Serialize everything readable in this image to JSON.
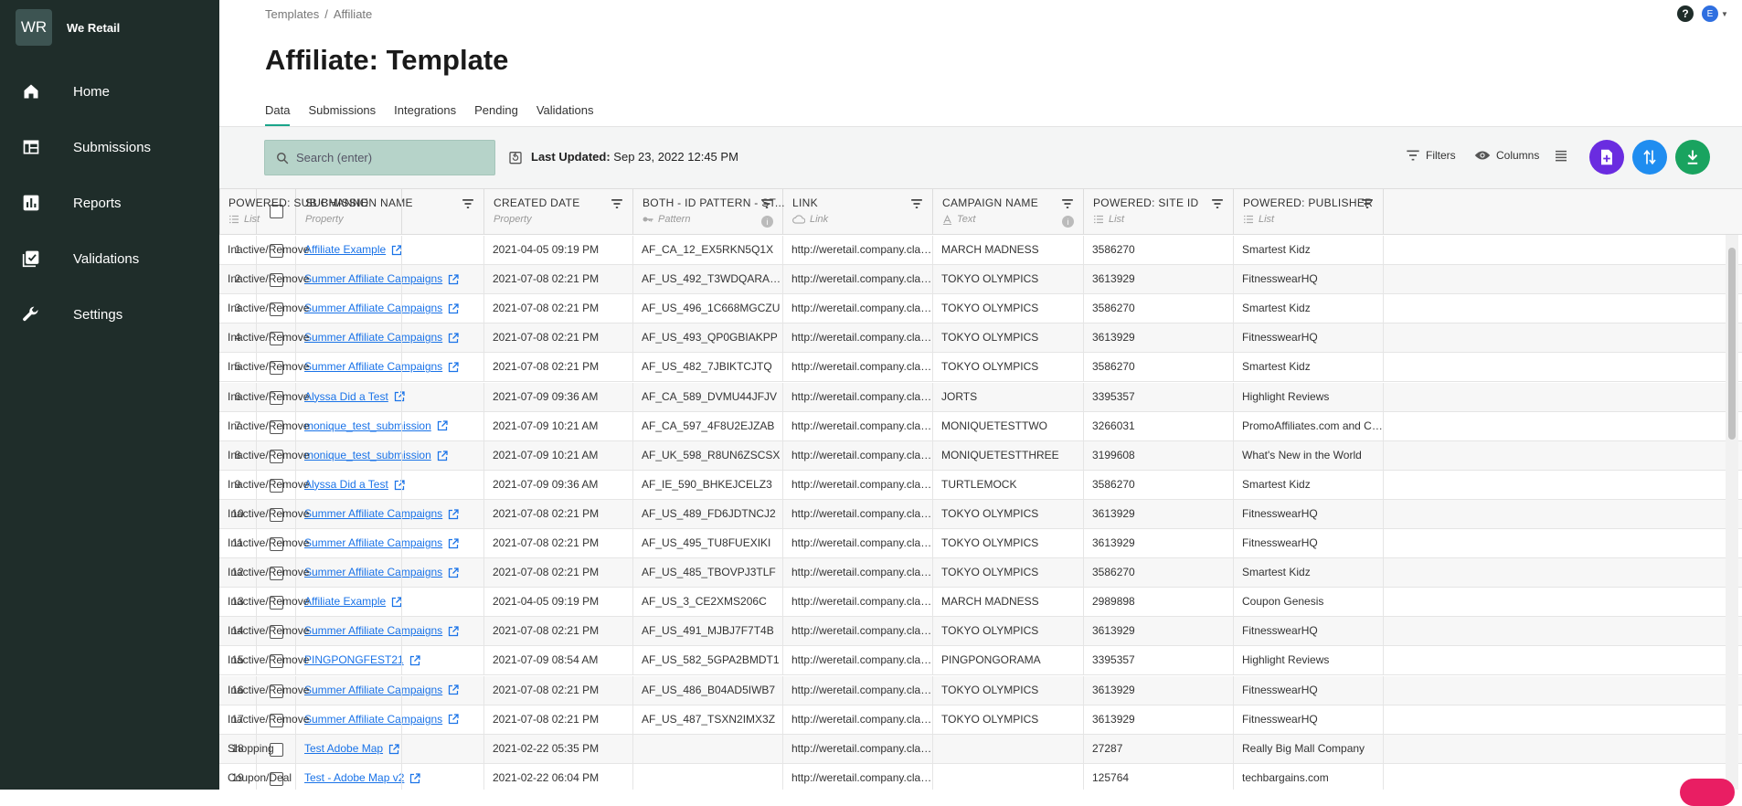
{
  "app": {
    "logo_text": "WR",
    "name": "We Retail"
  },
  "sidebar": {
    "items": [
      {
        "label": "Home",
        "icon": "home-icon"
      },
      {
        "label": "Submissions",
        "icon": "table-icon"
      },
      {
        "label": "Reports",
        "icon": "chart-icon"
      },
      {
        "label": "Validations",
        "icon": "checklist-icon"
      },
      {
        "label": "Settings",
        "icon": "wrench-icon"
      }
    ]
  },
  "breadcrumb": {
    "parent": "Templates",
    "sep": "/",
    "current": "Affiliate"
  },
  "header": {
    "help": "?",
    "user_initial": "E",
    "title": "Affiliate: Template"
  },
  "tabs": [
    "Data",
    "Submissions",
    "Integrations",
    "Pending",
    "Validations"
  ],
  "toolbar": {
    "search_placeholder": "Search (enter)",
    "last_updated_label": "Last Updated:",
    "last_updated_value": "Sep 23, 2022 12:45 PM",
    "filters_label": "Filters",
    "columns_label": "Columns"
  },
  "columns": [
    {
      "title": "SUBMISSION NAME",
      "type": "Property",
      "type_icon": ""
    },
    {
      "title": "CREATED DATE",
      "type": "Property",
      "type_icon": ""
    },
    {
      "title": "BOTH - ID PATTERN - ST...",
      "type": "Pattern",
      "type_icon": "key-icon"
    },
    {
      "title": "LINK",
      "type": "Link",
      "type_icon": "cloud-icon"
    },
    {
      "title": "CAMPAIGN NAME",
      "type": "Text",
      "type_icon": "text-icon"
    },
    {
      "title": "POWERED: SITE ID",
      "type": "List",
      "type_icon": "list-icon"
    },
    {
      "title": "POWERED: PUBLISHER",
      "type": "List",
      "type_icon": "list-icon"
    },
    {
      "title": "POWERED: SUB CHANNE",
      "type": "List",
      "type_icon": "list-icon"
    }
  ],
  "rows": [
    [
      "1",
      "Affiliate Example",
      "2021-04-05 09:19 PM",
      "AF_CA_12_EX5RKN5Q1X",
      "http://weretail.company.claravi...",
      "MARCH MADNESS",
      "3586270",
      "Smartest Kidz",
      "Inactive/Remove"
    ],
    [
      "2",
      "Summer Affiliate Campaigns",
      "2021-07-08 02:21 PM",
      "AF_US_492_T3WDQARA7M",
      "http://weretail.company.claravi...",
      "TOKYO OLYMPICS",
      "3613929",
      "FitnesswearHQ",
      "Inactive/Remove"
    ],
    [
      "3",
      "Summer Affiliate Campaigns",
      "2021-07-08 02:21 PM",
      "AF_US_496_1C668MGCZU",
      "http://weretail.company.claravi...",
      "TOKYO OLYMPICS",
      "3586270",
      "Smartest Kidz",
      "Inactive/Remove"
    ],
    [
      "4",
      "Summer Affiliate Campaigns",
      "2021-07-08 02:21 PM",
      "AF_US_493_QP0GBIAKPP",
      "http://weretail.company.claravi...",
      "TOKYO OLYMPICS",
      "3613929",
      "FitnesswearHQ",
      "Inactive/Remove"
    ],
    [
      "5",
      "Summer Affiliate Campaigns",
      "2021-07-08 02:21 PM",
      "AF_US_482_7JBIKTCJTQ",
      "http://weretail.company.claravi...",
      "TOKYO OLYMPICS",
      "3586270",
      "Smartest Kidz",
      "Inactive/Remove"
    ],
    [
      "6",
      "Alyssa Did a Test",
      "2021-07-09 09:36 AM",
      "AF_CA_589_DVMU44JFJV",
      "http://weretail.company.claravi...",
      "JORTS",
      "3395357",
      "Highlight Reviews",
      "Inactive/Remove"
    ],
    [
      "7",
      "monique_test_submission",
      "2021-07-09 10:21 AM",
      "AF_CA_597_4F8U2EJZAB",
      "http://weretail.company.claravi...",
      "MONIQUETESTTWO",
      "3266031",
      "PromoAffiliates.com and Coupo...",
      "Inactive/Remove"
    ],
    [
      "8",
      "monique_test_submission",
      "2021-07-09 10:21 AM",
      "AF_UK_598_R8UN6ZSCSX",
      "http://weretail.company.claravi...",
      "MONIQUETESTTHREE",
      "3199608",
      "What's New in the World",
      "Inactive/Remove"
    ],
    [
      "9",
      "Alyssa Did a Test",
      "2021-07-09 09:36 AM",
      "AF_IE_590_BHKEJCELZ3",
      "http://weretail.company.claravi...",
      "TURTLEMOCK",
      "3586270",
      "Smartest Kidz",
      "Inactive/Remove"
    ],
    [
      "10",
      "Summer Affiliate Campaigns",
      "2021-07-08 02:21 PM",
      "AF_US_489_FD6JDTNCJ2",
      "http://weretail.company.claravi...",
      "TOKYO OLYMPICS",
      "3613929",
      "FitnesswearHQ",
      "Inactive/Remove"
    ],
    [
      "11",
      "Summer Affiliate Campaigns",
      "2021-07-08 02:21 PM",
      "AF_US_495_TU8FUEXIKI",
      "http://weretail.company.claravi...",
      "TOKYO OLYMPICS",
      "3613929",
      "FitnesswearHQ",
      "Inactive/Remove"
    ],
    [
      "12",
      "Summer Affiliate Campaigns",
      "2021-07-08 02:21 PM",
      "AF_US_485_TBOVPJ3TLF",
      "http://weretail.company.claravi...",
      "TOKYO OLYMPICS",
      "3586270",
      "Smartest Kidz",
      "Inactive/Remove"
    ],
    [
      "13",
      "Affiliate Example",
      "2021-04-05 09:19 PM",
      "AF_US_3_CE2XMS206C",
      "http://weretail.company.claravi...",
      "MARCH MADNESS",
      "2989898",
      "Coupon Genesis",
      "Inactive/Remove"
    ],
    [
      "14",
      "Summer Affiliate Campaigns",
      "2021-07-08 02:21 PM",
      "AF_US_491_MJBJ7F7T4B",
      "http://weretail.company.claravi...",
      "TOKYO OLYMPICS",
      "3613929",
      "FitnesswearHQ",
      "Inactive/Remove"
    ],
    [
      "15",
      "PINGPONGFEST21",
      "2021-07-09 08:54 AM",
      "AF_US_582_5GPA2BMDT1",
      "http://weretail.company.claravi...",
      "PINGPONGORAMA",
      "3395357",
      "Highlight Reviews",
      "Inactive/Remove"
    ],
    [
      "16",
      "Summer Affiliate Campaigns",
      "2021-07-08 02:21 PM",
      "AF_US_486_B04AD5IWB7",
      "http://weretail.company.claravi...",
      "TOKYO OLYMPICS",
      "3613929",
      "FitnesswearHQ",
      "Inactive/Remove"
    ],
    [
      "17",
      "Summer Affiliate Campaigns",
      "2021-07-08 02:21 PM",
      "AF_US_487_TSXN2IMX3Z",
      "http://weretail.company.claravi...",
      "TOKYO OLYMPICS",
      "3613929",
      "FitnesswearHQ",
      "Inactive/Remove"
    ],
    [
      "18",
      "Test Adobe Map",
      "2021-02-22 05:35 PM",
      "",
      "http://weretail.company.claravi...",
      "",
      "27287",
      "Really Big Mall Company",
      "Shopping"
    ],
    [
      "19",
      "Test - Adobe Map v2",
      "2021-02-22 06:04 PM",
      "",
      "http://weretail.company.claravi...",
      "",
      "125764",
      "techbargains.com",
      "Coupon/Deal"
    ]
  ],
  "colors": {
    "sidebar_bg": "#1f2d2a",
    "accent": "#1aa58a",
    "link": "#1a73e8",
    "search_bg": "#b6d3c9"
  }
}
